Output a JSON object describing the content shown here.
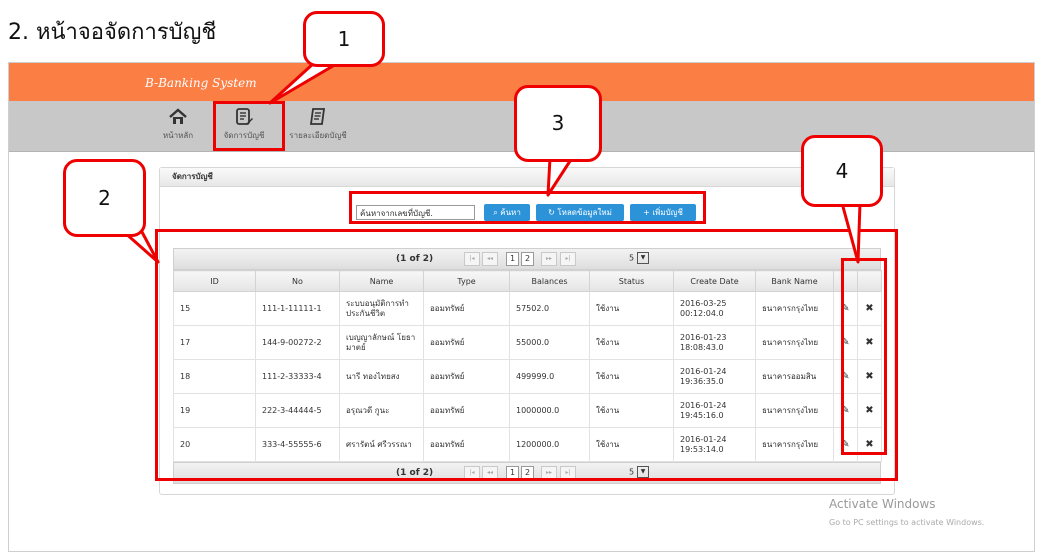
{
  "heading": "2. หน้าจอจัดการบัญชี",
  "app": {
    "brand": "B-Banking System",
    "toolbar": [
      {
        "label": "หน้าหลัก",
        "icon": "home-icon"
      },
      {
        "label": "จัดการบัญชี",
        "icon": "edit-list-icon"
      },
      {
        "label": "รายละเอียดบัญชี",
        "icon": "document-icon"
      }
    ]
  },
  "panel": {
    "title": "จัดการบัญชี",
    "search_placeholder": "ค้นหาจากเลขที่บัญชี.",
    "search_button": "ค้นหา",
    "reload_button": "โหลดข้อมูลใหม่",
    "add_button": "เพิ่มบัญชี"
  },
  "pager": {
    "status": "(1 of 2)",
    "pages": [
      "1",
      "2"
    ],
    "page_size": "5"
  },
  "table": {
    "headers": [
      "ID",
      "No",
      "Name",
      "Type",
      "Balances",
      "Status",
      "Create Date",
      "Bank Name"
    ],
    "rows": [
      {
        "id": "15",
        "no": "111-1-11111-1",
        "name": "ระบบอนุมัติการทำประกันชีวิต",
        "type": "ออมทรัพย์",
        "balance": "57502.0",
        "status": "ใช้งาน",
        "date": "2016-03-25 00:12:04.0",
        "bank": "ธนาคารกรุงไทย"
      },
      {
        "id": "17",
        "no": "144-9-00272-2",
        "name": "เบญญาลักษณ์ โยธามาตย์",
        "type": "ออมทรัพย์",
        "balance": "55000.0",
        "status": "ใช้งาน",
        "date": "2016-01-23 18:08:43.0",
        "bank": "ธนาคารกรุงไทย"
      },
      {
        "id": "18",
        "no": "111-2-33333-4",
        "name": "นารี ทองไทยสง",
        "type": "ออมทรัพย์",
        "balance": "499999.0",
        "status": "ใช้งาน",
        "date": "2016-01-24 19:36:35.0",
        "bank": "ธนาคารออมสิน"
      },
      {
        "id": "19",
        "no": "222-3-44444-5",
        "name": "อรุณวดี กูนะ",
        "type": "ออมทรัพย์",
        "balance": "1000000.0",
        "status": "ใช้งาน",
        "date": "2016-01-24 19:45:16.0",
        "bank": "ธนาคารกรุงไทย"
      },
      {
        "id": "20",
        "no": "333-4-55555-6",
        "name": "ศรารัตน์ ศรีวรรณา",
        "type": "ออมทรัพย์",
        "balance": "1200000.0",
        "status": "ใช้งาน",
        "date": "2016-01-24 19:53:14.0",
        "bank": "ธนาคารกรุงไทย"
      }
    ]
  },
  "callouts": [
    "1",
    "2",
    "3",
    "4"
  ],
  "watermark": {
    "title": "Activate Windows",
    "subtitle": "Go to PC settings to activate Windows."
  },
  "colors": {
    "banner": "#fb7e45",
    "button": "#2c93d9",
    "highlight": "#e00000"
  }
}
